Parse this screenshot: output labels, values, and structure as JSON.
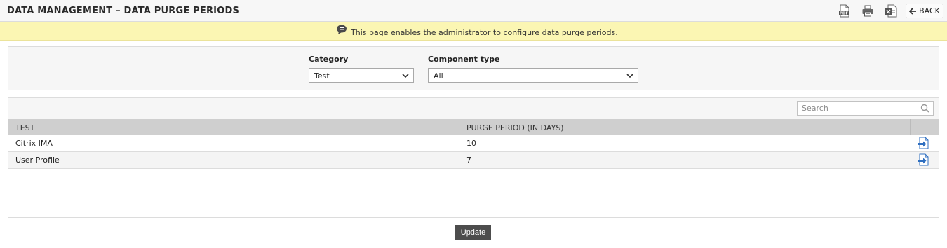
{
  "header": {
    "title": "DATA MANAGEMENT – DATA PURGE PERIODS",
    "back_label": "BACK",
    "pdf_icon_text": "PDF"
  },
  "info": {
    "message": "This page enables the administrator to configure data purge periods."
  },
  "filters": {
    "category": {
      "label": "Category",
      "value": "Test"
    },
    "component_type": {
      "label": "Component type",
      "value": "All"
    }
  },
  "search": {
    "placeholder": "Search",
    "value": ""
  },
  "table": {
    "columns": [
      "TEST",
      "PURGE PERIOD (IN DAYS)",
      ""
    ],
    "rows": [
      {
        "test": "Citrix IMA",
        "purge_period": "10"
      },
      {
        "test": "User Profile",
        "purge_period": "7"
      }
    ]
  },
  "actions": {
    "update_label": "Update"
  },
  "colors": {
    "info_background": "#fbf6b3",
    "header_row": "#cfcfcf",
    "update_button": "#4d4d4d",
    "row_action_icon": "#2f6fc0"
  }
}
